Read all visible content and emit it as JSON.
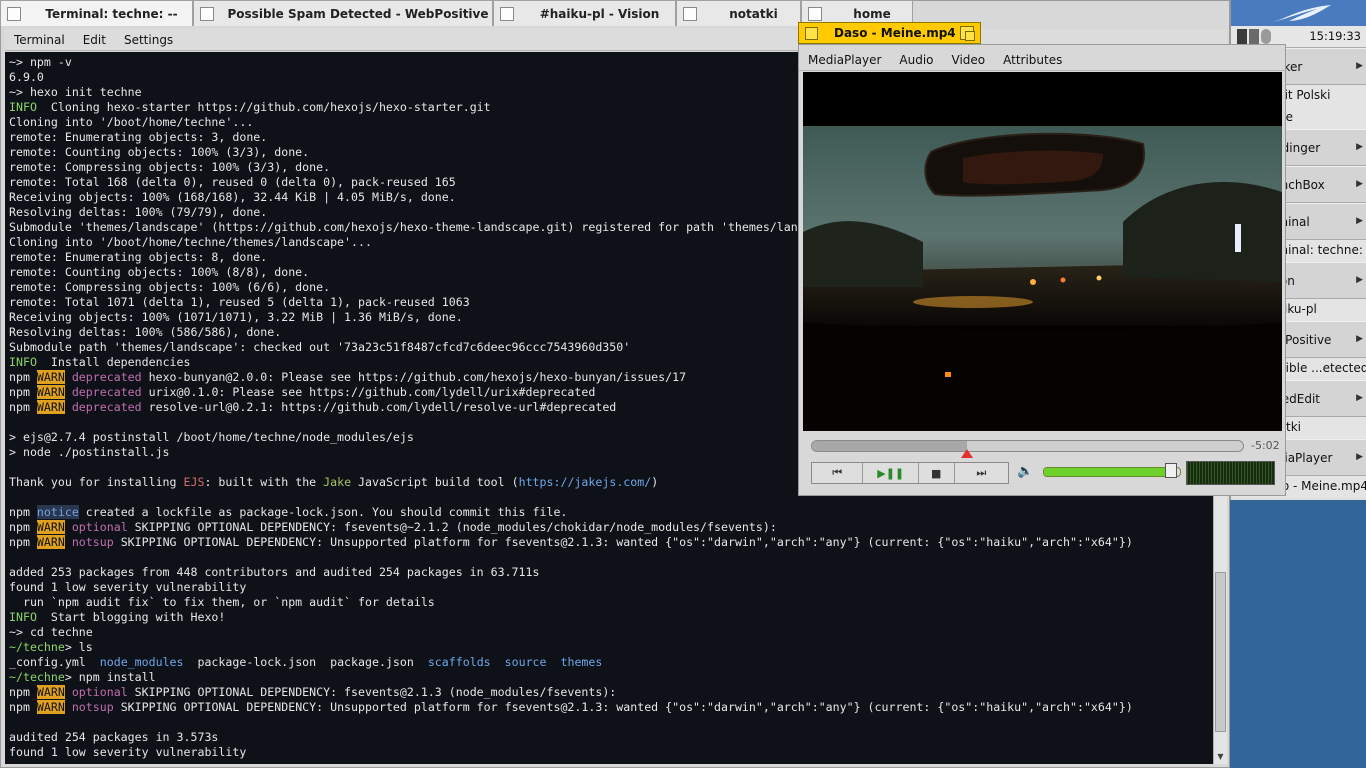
{
  "tabs": [
    {
      "title": "Terminal: techne: --",
      "active": true
    },
    {
      "title": "Possible Spam Detected - WebPositive",
      "active": false
    },
    {
      "title": "#haiku-pl - Vision",
      "active": false
    },
    {
      "title": "notatki",
      "active": false
    },
    {
      "title": "home",
      "active": false
    }
  ],
  "terminal": {
    "menu": [
      "Terminal",
      "Edit",
      "Settings"
    ],
    "colors": {
      "background": "#0e1117",
      "text": "#e6e6e6",
      "info": "#8cd36a",
      "warn_bg": "#e0a020",
      "deprecated": "#c06eb0",
      "directory": "#6ea6e8"
    },
    "lines": [
      [
        {
          "t": "~> npm -v"
        }
      ],
      [
        {
          "t": "6.9.0"
        }
      ],
      [
        {
          "t": "~> hexo init techne"
        }
      ],
      [
        {
          "t": "INFO ",
          "c": "info"
        },
        {
          "t": " Cloning hexo-starter https://github.com/hexojs/hexo-starter.git"
        }
      ],
      [
        {
          "t": "Cloning into '/boot/home/techne'..."
        }
      ],
      [
        {
          "t": "remote: Enumerating objects: 3, done."
        }
      ],
      [
        {
          "t": "remote: Counting objects: 100% (3/3), done."
        }
      ],
      [
        {
          "t": "remote: Compressing objects: 100% (3/3), done."
        }
      ],
      [
        {
          "t": "remote: Total 168 (delta 0), reused 0 (delta 0), pack-reused 165"
        }
      ],
      [
        {
          "t": "Receiving objects: 100% (168/168), 32.44 KiB | 4.05 MiB/s, done."
        }
      ],
      [
        {
          "t": "Resolving deltas: 100% (79/79), done."
        }
      ],
      [
        {
          "t": "Submodule 'themes/landscape' (https://github.com/hexojs/hexo-theme-landscape.git) registered for path 'themes/landscape'"
        }
      ],
      [
        {
          "t": "Cloning into '/boot/home/techne/themes/landscape'..."
        }
      ],
      [
        {
          "t": "remote: Enumerating objects: 8, done."
        }
      ],
      [
        {
          "t": "remote: Counting objects: 100% (8/8), done."
        }
      ],
      [
        {
          "t": "remote: Compressing objects: 100% (6/6), done."
        }
      ],
      [
        {
          "t": "remote: Total 1071 (delta 1), reused 5 (delta 1), pack-reused 1063"
        }
      ],
      [
        {
          "t": "Receiving objects: 100% (1071/1071), 3.22 MiB | 1.36 MiB/s, done."
        }
      ],
      [
        {
          "t": "Resolving deltas: 100% (586/586), done."
        }
      ],
      [
        {
          "t": "Submodule path 'themes/landscape': checked out '73a23c51f8487cfcd7c6deec96ccc7543960d350'"
        }
      ],
      [
        {
          "t": "INFO ",
          "c": "info"
        },
        {
          "t": " Install dependencies"
        }
      ],
      [
        {
          "t": "npm "
        },
        {
          "t": "WARN",
          "c": "warn"
        },
        {
          "t": " "
        },
        {
          "t": "deprecated",
          "c": "dep"
        },
        {
          "t": " hexo-bunyan@2.0.0: Please see https://github.com/hexojs/hexo-bunyan/issues/17"
        }
      ],
      [
        {
          "t": "npm "
        },
        {
          "t": "WARN",
          "c": "warn"
        },
        {
          "t": " "
        },
        {
          "t": "deprecated",
          "c": "dep"
        },
        {
          "t": " urix@0.1.0: Please see https://github.com/lydell/urix#deprecated"
        }
      ],
      [
        {
          "t": "npm "
        },
        {
          "t": "WARN",
          "c": "warn"
        },
        {
          "t": " "
        },
        {
          "t": "deprecated",
          "c": "dep"
        },
        {
          "t": " resolve-url@0.2.1: https://github.com/lydell/resolve-url#deprecated"
        }
      ],
      [
        {
          "t": ""
        }
      ],
      [
        {
          "t": "> ejs@2.7.4 postinstall /boot/home/techne/node_modules/ejs"
        }
      ],
      [
        {
          "t": "> node ./postinstall.js"
        }
      ],
      [
        {
          "t": ""
        }
      ],
      [
        {
          "t": "Thank you for installing "
        },
        {
          "t": "EJS",
          "c": "ejs"
        },
        {
          "t": ": built with the "
        },
        {
          "t": "Jake",
          "c": "jake"
        },
        {
          "t": " JavaScript build tool ("
        },
        {
          "t": "https://jakejs.com/",
          "c": "link"
        },
        {
          "t": ")"
        }
      ],
      [
        {
          "t": ""
        }
      ],
      [
        {
          "t": "npm "
        },
        {
          "t": "notice",
          "c": "notice"
        },
        {
          "t": " created a lockfile as package-lock.json. You should commit this file."
        }
      ],
      [
        {
          "t": "npm "
        },
        {
          "t": "WARN",
          "c": "warn"
        },
        {
          "t": " "
        },
        {
          "t": "optional",
          "c": "dep"
        },
        {
          "t": " SKIPPING OPTIONAL DEPENDENCY: fsevents@~2.1.2 (node_modules/chokidar/node_modules/fsevents):"
        }
      ],
      [
        {
          "t": "npm "
        },
        {
          "t": "WARN",
          "c": "warn"
        },
        {
          "t": " "
        },
        {
          "t": "notsup",
          "c": "dep"
        },
        {
          "t": " SKIPPING OPTIONAL DEPENDENCY: Unsupported platform for fsevents@2.1.3: wanted {\"os\":\"darwin\",\"arch\":\"any\"} (current: {\"os\":\"haiku\",\"arch\":\"x64\"})"
        }
      ],
      [
        {
          "t": ""
        }
      ],
      [
        {
          "t": "added 253 packages from 448 contributors and audited 254 packages in 63.711s"
        }
      ],
      [
        {
          "t": "found 1 low severity vulnerability"
        }
      ],
      [
        {
          "t": "  run `npm audit fix` to fix them, or `npm audit` for details"
        }
      ],
      [
        {
          "t": "INFO ",
          "c": "info"
        },
        {
          "t": " Start blogging with Hexo!"
        }
      ],
      [
        {
          "t": "~> cd techne"
        }
      ],
      [
        {
          "t": "~/techne",
          "c": "prompt"
        },
        {
          "t": "> ls"
        }
      ],
      [
        {
          "t": "_config.yml  "
        },
        {
          "t": "node_modules",
          "c": "dir"
        },
        {
          "t": "  package-lock.json  package.json  "
        },
        {
          "t": "scaffolds",
          "c": "dir"
        },
        {
          "t": "  "
        },
        {
          "t": "source",
          "c": "dir"
        },
        {
          "t": "  "
        },
        {
          "t": "themes",
          "c": "dir"
        }
      ],
      [
        {
          "t": "~/techne",
          "c": "prompt"
        },
        {
          "t": "> npm install"
        }
      ],
      [
        {
          "t": "npm "
        },
        {
          "t": "WARN",
          "c": "warn"
        },
        {
          "t": " "
        },
        {
          "t": "optional",
          "c": "dep"
        },
        {
          "t": " SKIPPING OPTIONAL DEPENDENCY: fsevents@2.1.3 (node_modules/fsevents):"
        }
      ],
      [
        {
          "t": "npm "
        },
        {
          "t": "WARN",
          "c": "warn"
        },
        {
          "t": " "
        },
        {
          "t": "notsup",
          "c": "dep"
        },
        {
          "t": " SKIPPING OPTIONAL DEPENDENCY: Unsupported platform for fsevents@2.1.3: wanted {\"os\":\"darwin\",\"arch\":\"any\"} (current: {\"os\":\"haiku\",\"arch\":\"x64\"})"
        }
      ],
      [
        {
          "t": ""
        }
      ],
      [
        {
          "t": "audited 254 packages in 3.573s"
        }
      ],
      [
        {
          "t": "found 1 low severity vulnerability"
        }
      ]
    ]
  },
  "mediaplayer": {
    "title": "Daso - Meine.mp4",
    "menu": [
      "MediaPlayer",
      "Audio",
      "Video",
      "Attributes"
    ],
    "time_remaining": "-5:02",
    "position_fraction": 0.36,
    "volume_fraction": 0.93,
    "playing": false,
    "colors": {
      "tab": "#ffcb00",
      "volume": "#6ed02a",
      "marker": "#e03030"
    },
    "icons": {
      "prev": "skip-back-icon",
      "play": "play-pause-icon",
      "stop": "stop-icon",
      "next": "skip-forward-icon",
      "volume": "speaker-icon"
    }
  },
  "deskbar": {
    "clock": "15:19:33",
    "accent": "#4b7bbf",
    "items": [
      {
        "label": "Tracker",
        "kind": "group"
      },
      {
        "label": "Pulpit Polski",
        "kind": "win"
      },
      {
        "label": "home",
        "kind": "win"
      },
      {
        "label": "Clipdinger",
        "kind": "group"
      },
      {
        "label": "LaunchBox",
        "kind": "group"
      },
      {
        "label": "Terminal",
        "kind": "group"
      },
      {
        "label": "Terminal: techne: --",
        "kind": "win"
      },
      {
        "label": "Vision",
        "kind": "group"
      },
      {
        "label": "#haiku-pl",
        "kind": "win"
      },
      {
        "label": "WebPositive",
        "kind": "group"
      },
      {
        "label": "Possible ...etected",
        "kind": "win"
      },
      {
        "label": "StyledEdit",
        "kind": "group"
      },
      {
        "label": "notatki",
        "kind": "win"
      },
      {
        "label": "MediaPlayer",
        "kind": "group"
      },
      {
        "label": "Daso - Meine.mp4",
        "kind": "win"
      }
    ]
  }
}
